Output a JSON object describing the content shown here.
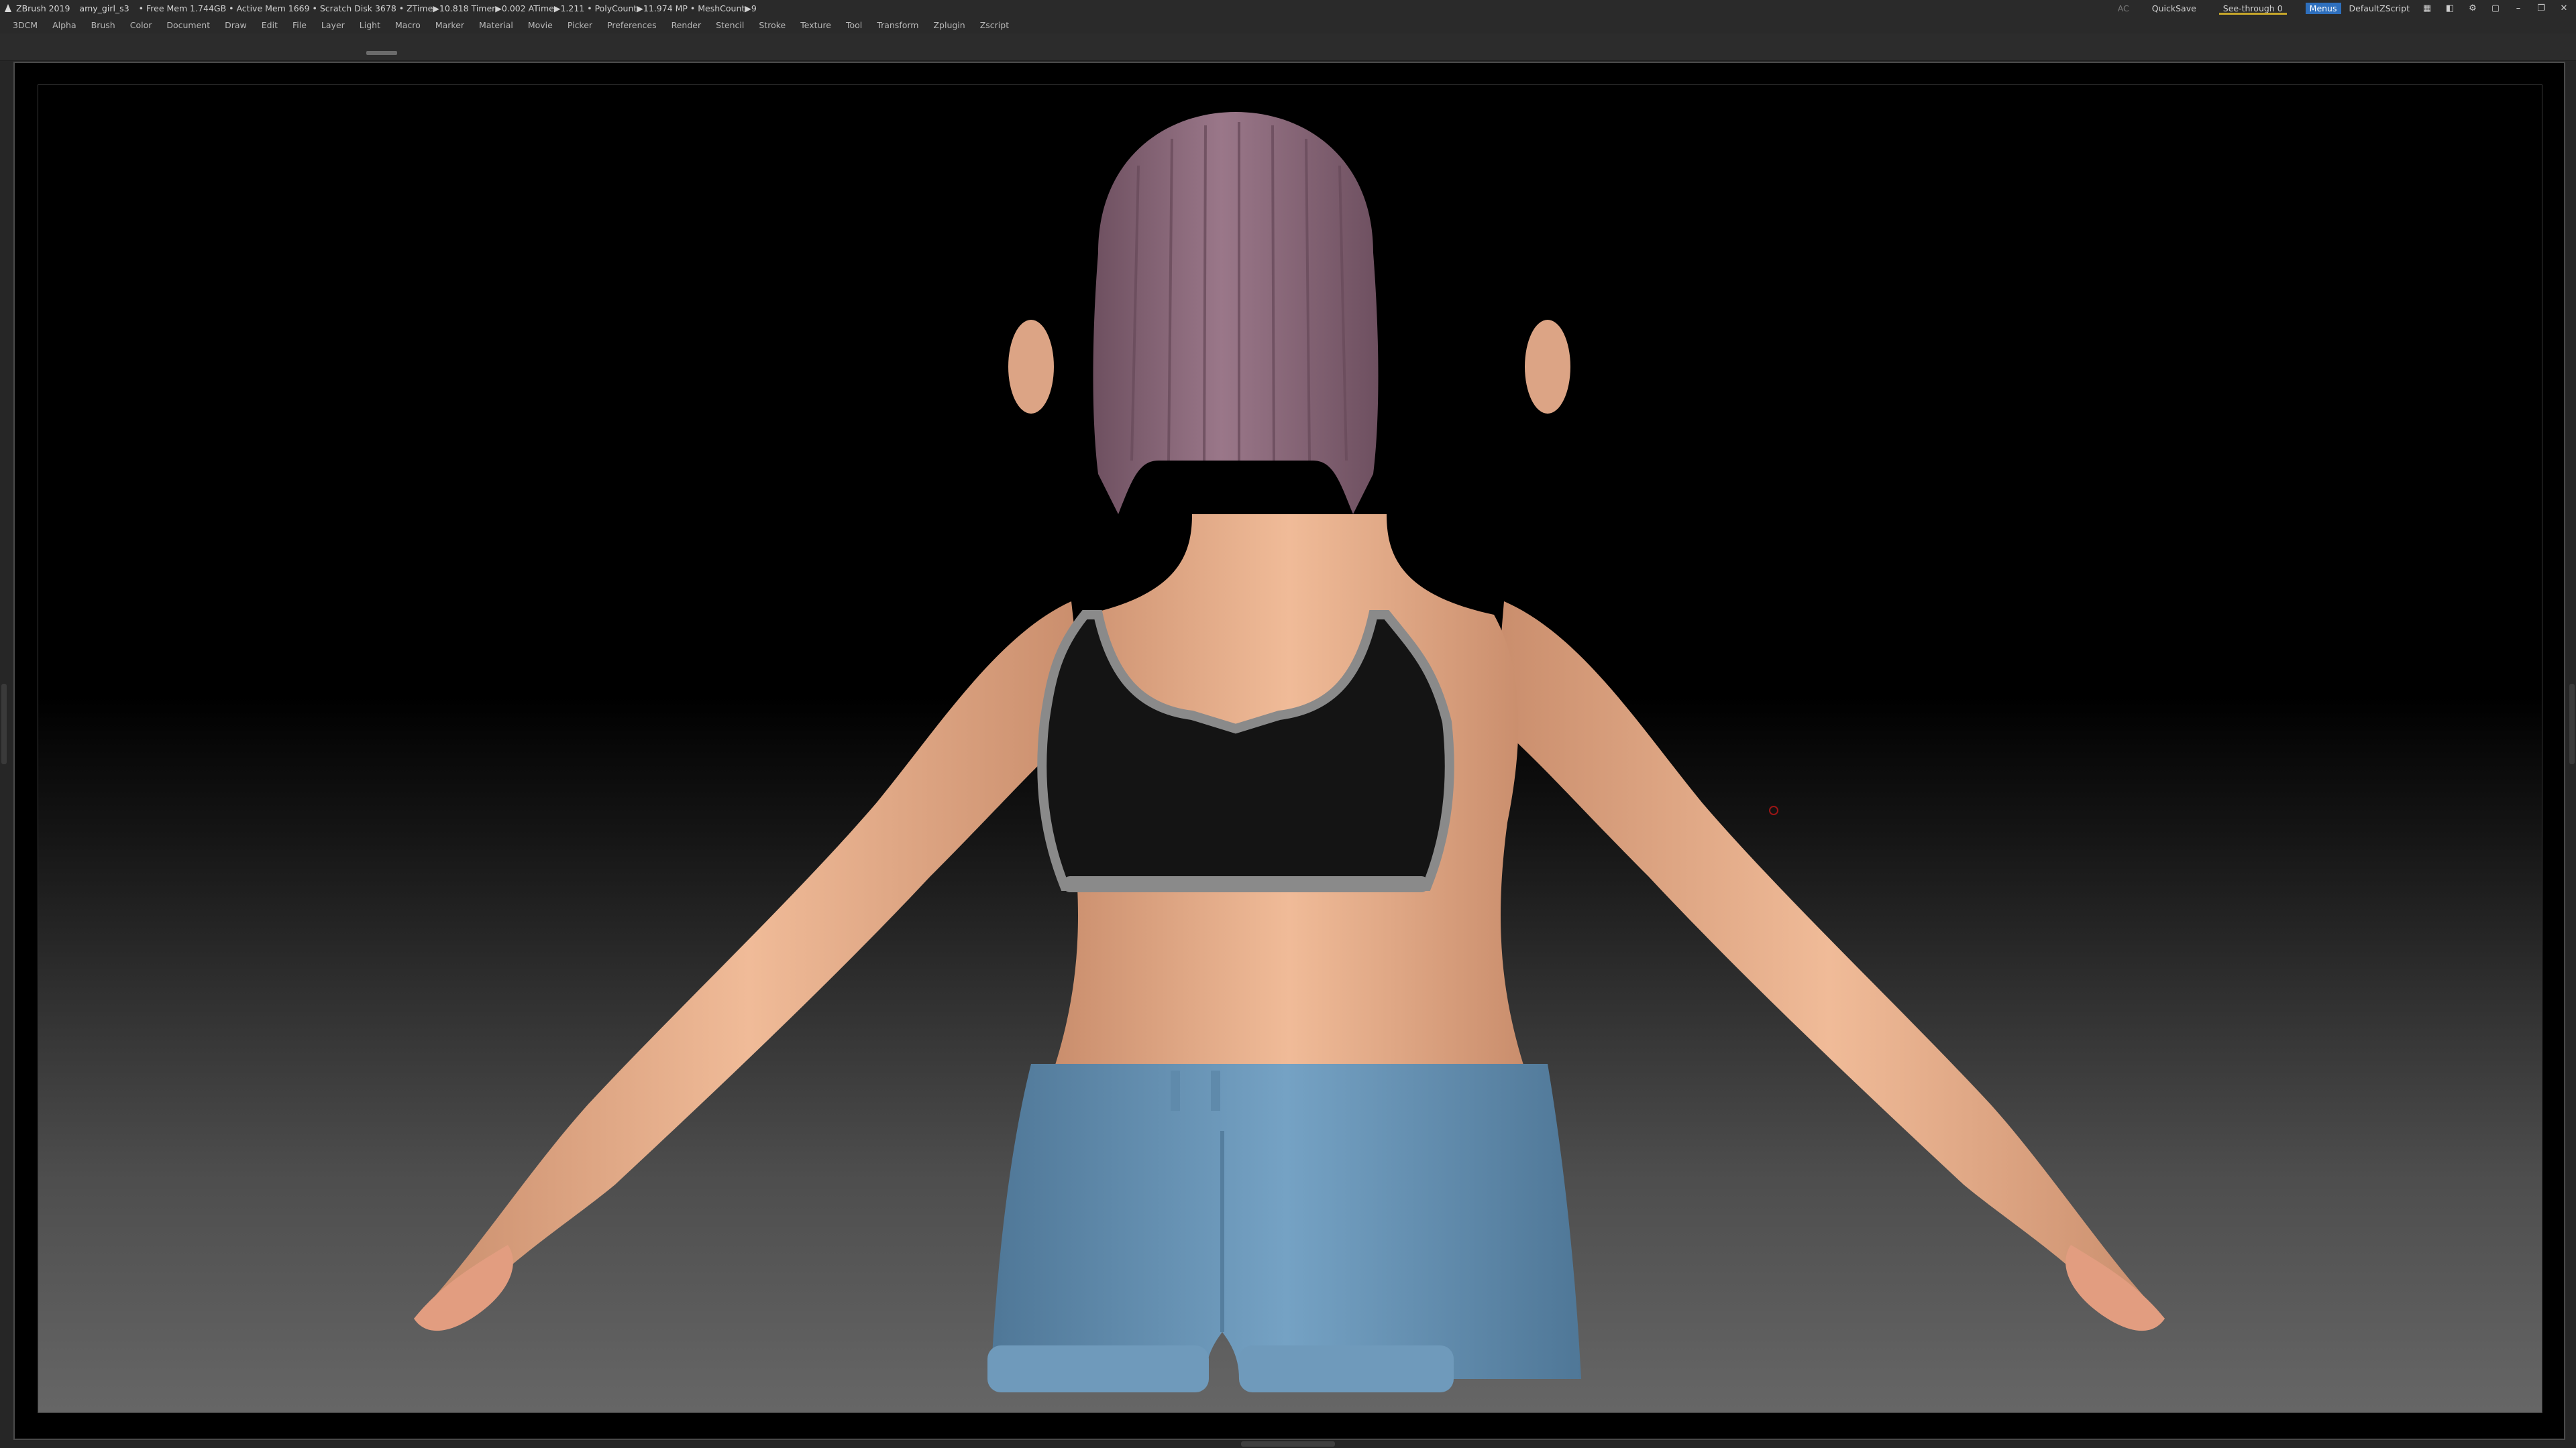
{
  "titlebar": {
    "app_name": "ZBrush 2019",
    "file_name": "amy_girl_s3",
    "status": "• Free Mem 1.744GB • Active Mem 1669 • Scratch Disk 3678 •  ZTime▶10.818 Timer▶0.002 ATime▶1.211 • PolyCount▶11.974 MP • MeshCount▶9",
    "ac_label": "AC",
    "quicksave_label": "QuickSave",
    "seethrough_label": "See-through   0",
    "menus_label": "Menus",
    "script_label": "DefaultZScript"
  },
  "menubar": {
    "items": [
      "3DCM",
      "Alpha",
      "Brush",
      "Color",
      "Document",
      "Draw",
      "Edit",
      "File",
      "Layer",
      "Light",
      "Macro",
      "Marker",
      "Material",
      "Movie",
      "Picker",
      "Preferences",
      "Render",
      "Stencil",
      "Stroke",
      "Texture",
      "Tool",
      "Transform",
      "Zplugin",
      "Zscript"
    ]
  },
  "colors": {
    "ui_bg": "#2a2a2a",
    "accent_yellow": "#c7a72a",
    "menus_blue": "#2e6fbd",
    "skin": "#e8b08c",
    "hair": "#8e6a7e",
    "top": "#151515",
    "trim": "#8a8a8a",
    "shorts": "#6a96b8"
  },
  "icons": [
    "zbrush-logo-icon",
    "layout-icon",
    "palette-icon",
    "gear-icon",
    "lock-icon",
    "minimize-icon",
    "restore-icon",
    "close-icon"
  ]
}
